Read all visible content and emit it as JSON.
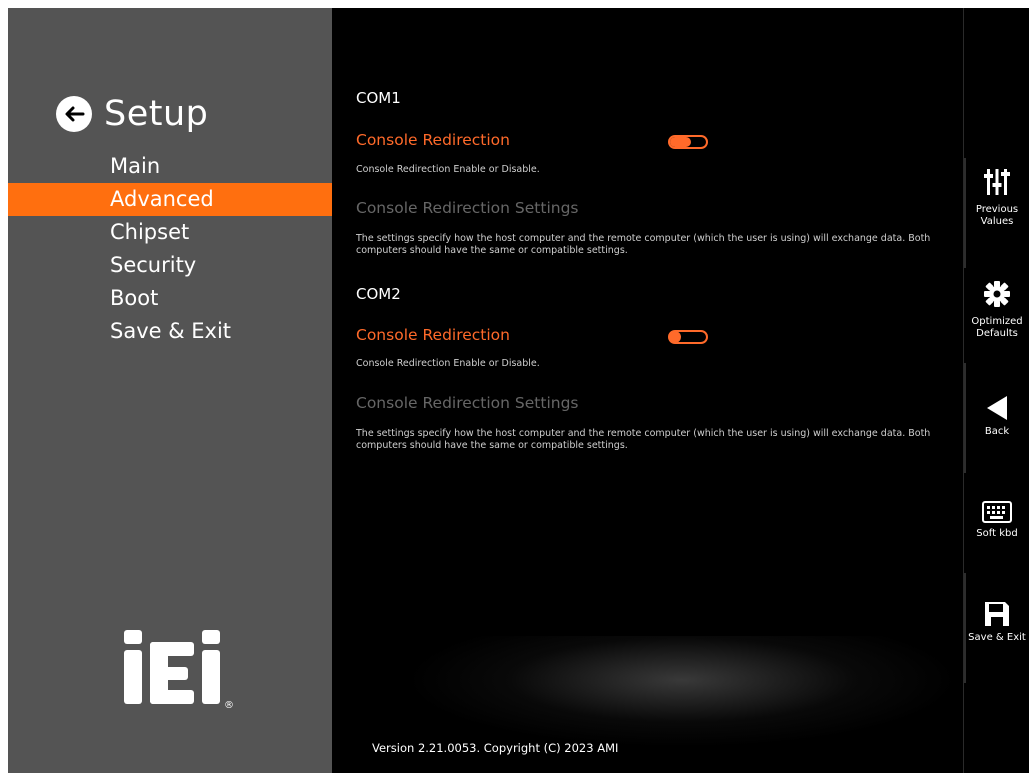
{
  "sidebar": {
    "title": "Setup",
    "menu": [
      "Main",
      "Advanced",
      "Chipset",
      "Security",
      "Boot",
      "Save & Exit"
    ],
    "active": "Advanced"
  },
  "content": {
    "com1": {
      "label": "COM1",
      "console_redirection": {
        "title": "Console Redirection",
        "desc": "Console Redirection Enable or Disable.",
        "state": "on"
      },
      "settings": {
        "title": "Console Redirection Settings",
        "desc": "The settings specify how the host computer and the remote computer (which the user is using) will exchange data. Both computers should have the same or compatible settings."
      }
    },
    "com2": {
      "label": "COM2",
      "console_redirection": {
        "title": "Console Redirection",
        "desc": "Console Redirection Enable or Disable.",
        "state": "off"
      },
      "settings": {
        "title": "Console Redirection Settings",
        "desc": "The settings specify how the host computer and the remote computer (which the user is using) will exchange data. Both computers should have the same or compatible settings."
      }
    }
  },
  "version": "Version 2.21.0053. Copyright (C) 2023 AMI",
  "toolbar": {
    "previous": "Previous Values",
    "optimized": "Optimized Defaults",
    "back": "Back",
    "soft_kbd": "Soft kbd",
    "save_exit": "Save & Exit"
  },
  "logo": {
    "text": "iEi",
    "reg": "®"
  },
  "colors": {
    "accent": "#ff6f0f",
    "sidebar": "#545454",
    "background": "#000000",
    "disabled": "#666666"
  }
}
